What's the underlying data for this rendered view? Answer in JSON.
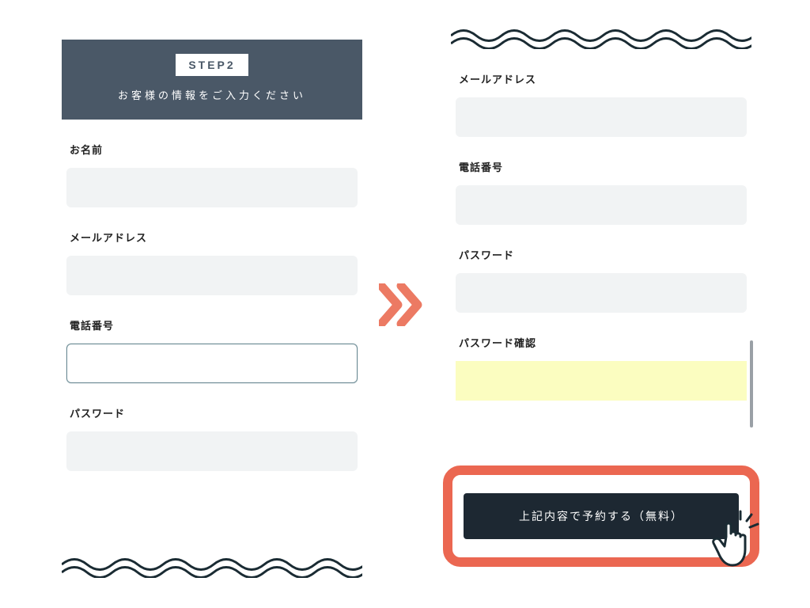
{
  "step": {
    "badge": "STEP2",
    "subtitle": "お客様の情報をご入力ください"
  },
  "left_form": {
    "fields": [
      {
        "label": "お名前"
      },
      {
        "label": "メールアドレス"
      },
      {
        "label": "電話番号"
      },
      {
        "label": "パスワード"
      }
    ]
  },
  "right_form": {
    "fields": [
      {
        "label": "メールアドレス"
      },
      {
        "label": "電話番号"
      },
      {
        "label": "パスワード"
      },
      {
        "label": "パスワード確認"
      }
    ]
  },
  "cta": {
    "label": "上記内容で予約する（無料）"
  }
}
